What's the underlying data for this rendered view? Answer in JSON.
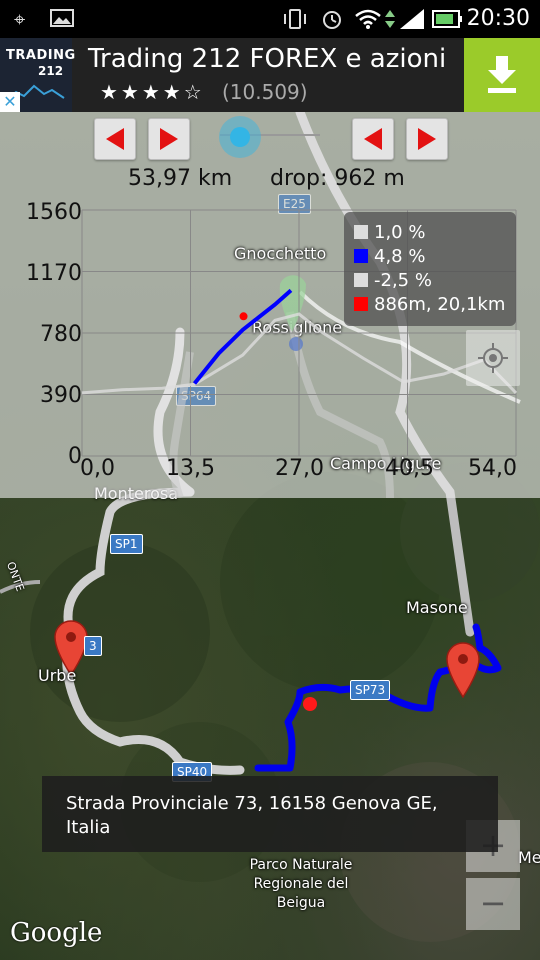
{
  "status_bar": {
    "time": "20:30",
    "icons": [
      "gps-icon",
      "image-icon",
      "vibrate-icon",
      "alarm-icon",
      "wifi-icon",
      "signal-icon",
      "battery-icon"
    ]
  },
  "ad": {
    "logo_line1": "TRADING",
    "logo_line2": "212",
    "title": "Trading 212 FOREX e azioni",
    "stars": "★★★★☆",
    "reviews": "(10.509)",
    "close": "✕",
    "accent_color": "#9bcb2a"
  },
  "profile": {
    "distance": "53,97 km",
    "drop": "drop: 962 m",
    "slider_value": 0.2,
    "y_ticks": [
      "1560",
      "1170",
      "780",
      "390",
      "0"
    ],
    "x_ticks": [
      "0,0",
      "13,5",
      "27,0",
      "40,5",
      "54,0"
    ],
    "legend": [
      {
        "label": "1,0 %",
        "color": "#dddddd"
      },
      {
        "label": "4,8 %",
        "color": "#0000ff"
      },
      {
        "label": "-2,5 %",
        "color": "#dddddd"
      },
      {
        "label": "886m, 20,1km",
        "color": "#ff0000"
      }
    ]
  },
  "chart_data": {
    "type": "line",
    "xlim": [
      0,
      54
    ],
    "ylim": [
      0,
      1560
    ],
    "grid": true,
    "legend_position": "top-right",
    "series": [
      {
        "name": "1,0 %",
        "color": "#dddddd",
        "x": [
          0,
          5,
          10,
          14,
          20,
          24,
          27,
          30,
          35,
          40,
          45,
          50,
          54
        ],
        "y": [
          400,
          420,
          430,
          455,
          640,
          860,
          900,
          780,
          620,
          470,
          520,
          610,
          400
        ]
      },
      {
        "name": "4,8 %",
        "color": "#0000ff",
        "x": [
          14,
          17,
          20,
          22,
          24,
          26
        ],
        "y": [
          460,
          650,
          800,
          880,
          960,
          1050
        ]
      }
    ],
    "marker": {
      "label": "886m, 20,1km",
      "x": 20.1,
      "y": 886,
      "color": "#ff0000"
    }
  },
  "map": {
    "places": [
      {
        "name": "Gnocchetto"
      },
      {
        "name": "Rossiglione"
      },
      {
        "name": "Campo Ligure"
      },
      {
        "name": "Monterosa"
      },
      {
        "name": "Masone"
      },
      {
        "name": "Urbe"
      },
      {
        "name": "Parco Naturale Regionale del Beigua"
      },
      {
        "name": "Me"
      },
      {
        "name": "ONTE"
      }
    ],
    "road_labels": [
      "E25",
      "SP64",
      "SP1",
      "SP73",
      "SP40",
      "3"
    ],
    "address": "Strada Provinciale 73, 16158 Genova GE, Italia",
    "zoom_in": "+",
    "zoom_out": "−",
    "attribution": "Google"
  }
}
